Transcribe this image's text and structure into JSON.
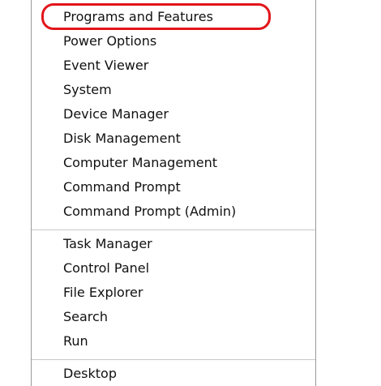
{
  "menu": {
    "groups": [
      {
        "items": [
          {
            "label": "Programs and Features"
          },
          {
            "label": "Power Options"
          },
          {
            "label": "Event Viewer"
          },
          {
            "label": "System"
          },
          {
            "label": "Device Manager"
          },
          {
            "label": "Disk Management"
          },
          {
            "label": "Computer Management"
          },
          {
            "label": "Command Prompt"
          },
          {
            "label": "Command Prompt (Admin)"
          }
        ]
      },
      {
        "items": [
          {
            "label": "Task Manager"
          },
          {
            "label": "Control Panel"
          },
          {
            "label": "File Explorer"
          },
          {
            "label": "Search"
          },
          {
            "label": "Run"
          }
        ]
      },
      {
        "items": [
          {
            "label": "Desktop"
          }
        ]
      }
    ]
  },
  "annotation": {
    "highlighted_item": "Programs and Features",
    "color": "#e2151b"
  }
}
